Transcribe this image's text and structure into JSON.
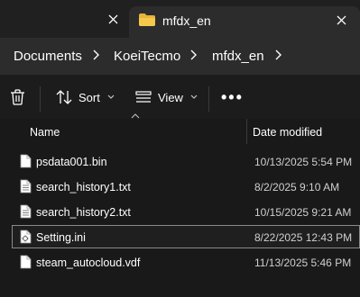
{
  "tabs": {
    "active_title": "mfdx_en",
    "close_label": "✕"
  },
  "breadcrumb": {
    "items": [
      "Documents",
      "KoeiTecmo",
      "mfdx_en"
    ],
    "separator": "›"
  },
  "commandbar": {
    "sort_label": "Sort",
    "view_label": "View",
    "more_label": "•••"
  },
  "columns": {
    "name": "Name",
    "date_modified": "Date modified"
  },
  "files": [
    {
      "name": "psdata001.bin",
      "date": "10/13/2025 5:54 PM",
      "selected": false
    },
    {
      "name": "search_history1.txt",
      "date": "8/2/2025 9:10 AM",
      "selected": false
    },
    {
      "name": "search_history2.txt",
      "date": "10/15/2025 9:21 AM",
      "selected": false
    },
    {
      "name": "Setting.ini",
      "date": "8/22/2025 12:43 PM",
      "selected": true
    },
    {
      "name": "steam_autocloud.vdf",
      "date": "11/13/2025 5:46 PM",
      "selected": false
    }
  ],
  "colors": {
    "folder": "#e8b339",
    "background": "#191919",
    "selection_border": "#8a8a8a"
  }
}
